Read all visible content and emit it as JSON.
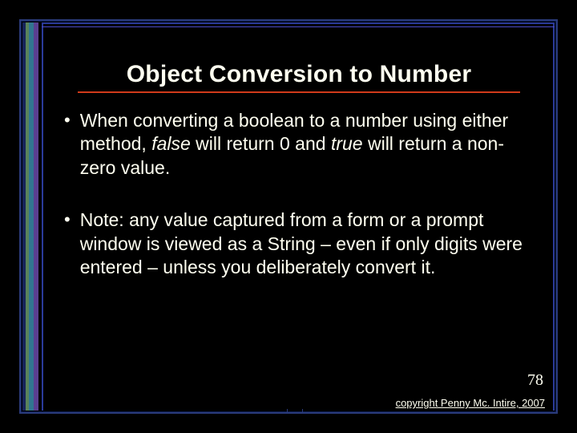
{
  "title": "Object Conversion to Number",
  "bullets": [
    {
      "pre": "When converting a boolean to a number using either method, ",
      "em1": "false",
      "mid": " will return 0 and ",
      "em2": "true",
      "post": " will return a non-zero value."
    },
    {
      "pre": "Note: any value captured from a form or a prompt window is viewed as a String – even if only digits were entered – unless you deliberately convert it.",
      "em1": "",
      "mid": "",
      "em2": "",
      "post": ""
    }
  ],
  "page_number": "78",
  "copyright": "copyright Penny Mc. Intire, 2007"
}
